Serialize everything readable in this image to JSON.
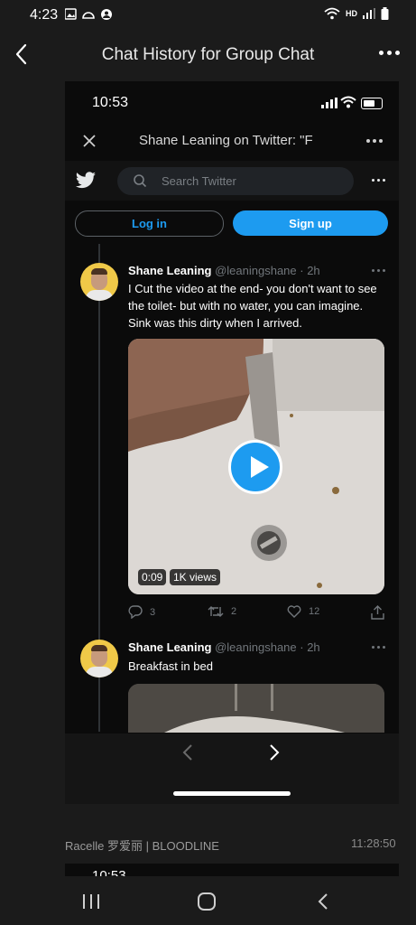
{
  "status_bar": {
    "time": "4:23",
    "network": "HD"
  },
  "app_bar": {
    "title": "Chat History for Group Chat"
  },
  "message": {
    "inner_status": {
      "time": "10:53"
    },
    "webview": {
      "title": "Shane Leaning on Twitter: \"F"
    },
    "twitter": {
      "search_placeholder": "Search Twitter",
      "login_label": "Log in",
      "signup_label": "Sign up",
      "tweets": [
        {
          "name": "Shane Leaning",
          "handle": "@leaningshane",
          "time": "· 2h",
          "text": "I Cut the video at the end- you don't want to see the toilet- but with no water, you can imagine. Sink was this dirty when I arrived.",
          "video_duration": "0:09",
          "video_views": "1K views",
          "replies": "3",
          "retweets": "2",
          "likes": "12"
        },
        {
          "name": "Shane Leaning",
          "handle": "@leaningshane",
          "time": "· 2h",
          "text": "Breakfast in bed"
        }
      ]
    }
  },
  "next_message": {
    "sender": "Racelle 罗爱丽 | BLOODLINE",
    "time": "11:28:50",
    "inner_status_time": "10:53"
  },
  "colors": {
    "accent": "#1d9bf0",
    "background": "#1b1b1b"
  }
}
